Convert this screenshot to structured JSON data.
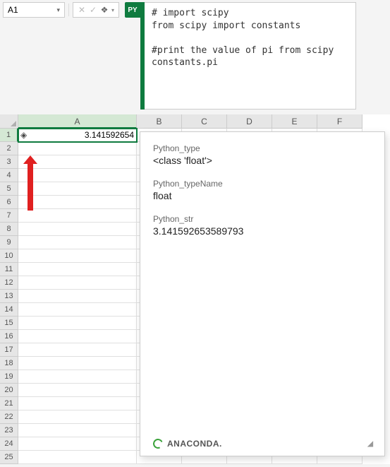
{
  "namebox": {
    "value": "A1"
  },
  "code": {
    "line1": "# import scipy",
    "line2": "from scipy import constants",
    "line3": "",
    "line4": "#print the value of pi from scipy",
    "line5": "constants.pi"
  },
  "py_badge": "PY",
  "columns": [
    "A",
    "B",
    "C",
    "D",
    "E",
    "F"
  ],
  "rows": 25,
  "cellA1": {
    "icon": "◈",
    "value": "3.141592654"
  },
  "popup": {
    "type_label": "Python_type",
    "type_value": "<class 'float'>",
    "typename_label": "Python_typeName",
    "typename_value": "float",
    "str_label": "Python_str",
    "str_value": "3.141592653589793",
    "brand": "ANACONDA."
  }
}
